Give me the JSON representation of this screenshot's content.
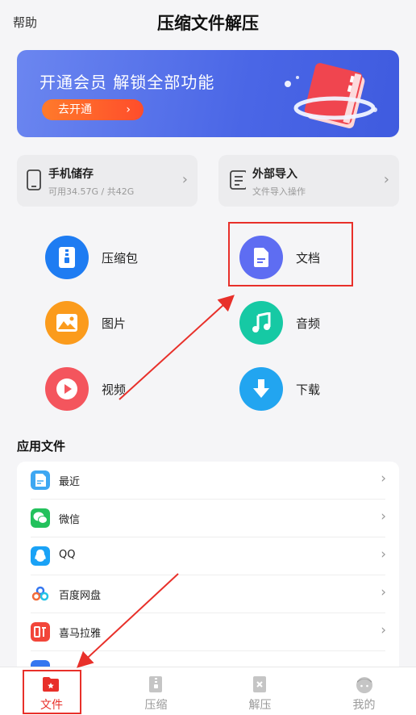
{
  "header": {
    "help": "帮助",
    "title": "压缩文件解压"
  },
  "banner": {
    "text": "开通会员 解锁全部功能",
    "button": "去开通",
    "chevron": "›"
  },
  "storage": [
    {
      "title": "手机储存",
      "sub": "可用34.57G / 共42G",
      "icon": "phone-icon"
    },
    {
      "title": "外部导入",
      "sub": "文件导入操作",
      "icon": "document-import-icon"
    }
  ],
  "categories": [
    {
      "label": "压缩包",
      "icon": "zip-icon",
      "color": "#1e7cf2"
    },
    {
      "label": "文档",
      "icon": "document-icon",
      "color": "#5e6df2"
    },
    {
      "label": "图片",
      "icon": "image-icon",
      "color": "#fb9b1c"
    },
    {
      "label": "音频",
      "icon": "music-icon",
      "color": "#16c9a4"
    },
    {
      "label": "视频",
      "icon": "play-icon",
      "color": "#f4555d"
    },
    {
      "label": "下载",
      "icon": "download-icon",
      "color": "#22a5f0"
    }
  ],
  "section": {
    "title": "应用文件"
  },
  "apps": [
    {
      "label": "最近",
      "icon": "recent-file-icon",
      "color": "#3ea7f2"
    },
    {
      "label": "微信",
      "icon": "wechat-icon",
      "color": "#23c15c"
    },
    {
      "label": "QQ",
      "icon": "qq-icon",
      "color": "#1aa2f6"
    },
    {
      "label": "百度网盘",
      "icon": "baidu-netdisk-icon",
      "color": "#3577f0"
    },
    {
      "label": "喜马拉雅",
      "icon": "ximalaya-icon",
      "color": "#f2463a"
    }
  ],
  "tabs": [
    {
      "label": "文件",
      "icon": "file-folder-icon",
      "active": true
    },
    {
      "label": "压缩",
      "icon": "compress-icon",
      "active": false
    },
    {
      "label": "解压",
      "icon": "decompress-icon",
      "active": false
    },
    {
      "label": "我的",
      "icon": "profile-icon",
      "active": false
    }
  ],
  "colors": {
    "accent": "#e8302a",
    "banner": "#4a66e6",
    "button": "#ff5a2b"
  }
}
